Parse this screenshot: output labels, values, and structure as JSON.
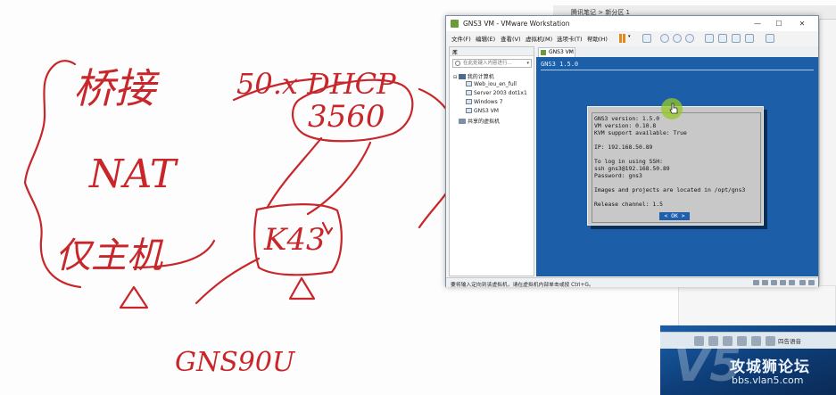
{
  "background_window": {
    "title": "腾讯笔记 > 新分区 1"
  },
  "annotations": {
    "bridge": "桥接",
    "nat": "NAT",
    "host_only": "仅主机",
    "dhcp": "50.x DHCP",
    "switch": "3560",
    "router": "K43",
    "gns": "GNS90U"
  },
  "vmware": {
    "title": "GNS3 VM - VMware Workstation",
    "menu": [
      "文件(F)",
      "编辑(E)",
      "查看(V)",
      "虚拟机(M)",
      "选项卡(T)",
      "帮助(H)"
    ],
    "library": {
      "header": "库",
      "close": "×",
      "search_placeholder": "在此处键入内容进行...",
      "tree": {
        "root": "我的计算机",
        "vms": [
          "Web_iou_en_full",
          "Server 2003 dot1x1",
          "Windows 7",
          "GNS3 VM"
        ],
        "shared": "共享的虚拟机"
      }
    },
    "tab": {
      "label": "GNS3 VM",
      "close": "×"
    },
    "console": {
      "header": "GNS3 1.5.0",
      "dialog_lines": [
        "GNS3 version: 1.5.0",
        "VM version: 0.10.8",
        "KVM support available: True",
        "",
        "IP: 192.168.50.89",
        "",
        "To log in using SSH:",
        "ssh gns3@192.168.50.89",
        "Password: gns3",
        "",
        "Images and projects are located in /opt/gns3",
        "",
        "Release channel: 1.5"
      ],
      "ok_label": "< OK >"
    },
    "status_message": "要将输入定向到该虚拟机，请在虚拟机内部单击或按 Ctrl+G。"
  },
  "watermark": {
    "logo": "V5",
    "title": "攻城狮论坛",
    "url": "bbs.vlan5.com"
  },
  "taskbar": {
    "live_label": "四告语音"
  }
}
